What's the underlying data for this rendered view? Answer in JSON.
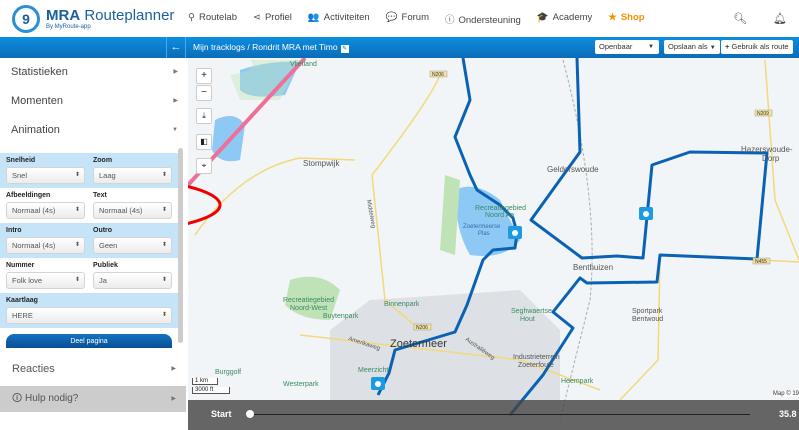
{
  "header": {
    "brand": "MRA Routeplanner",
    "brand_bold": "MRA",
    "brand_rest": "Routeplanner",
    "tagline": "By MyRoute-app",
    "nav": [
      {
        "label": "Routelab",
        "icon": "map-pin-icon"
      },
      {
        "label": "Profiel",
        "icon": "share-icon"
      },
      {
        "label": "Activiteiten",
        "icon": "users-icon"
      },
      {
        "label": "Forum",
        "icon": "comments-icon"
      },
      {
        "label": "Ondersteuning",
        "icon": "info-icon"
      },
      {
        "label": "Academy",
        "icon": "graduation-cap-icon"
      },
      {
        "label": "Shop",
        "icon": "star-icon"
      }
    ]
  },
  "toolbar": {
    "breadcrumb_root": "Mijn tracklogs",
    "breadcrumb_sep": "/",
    "breadcrumb_current": "Rondrit MRA met Timo",
    "visibility": "Openbaar",
    "save_as": "Opslaan als",
    "use_as_route": "Gebruik als route"
  },
  "sidebar": {
    "sections": [
      "Statistieken",
      "Momenten",
      "Animation"
    ],
    "fields": {
      "snelheid": {
        "label": "Snelheid",
        "value": "Snel"
      },
      "zoom": {
        "label": "Zoom",
        "value": "Laag"
      },
      "afbeeldingen": {
        "label": "Afbeeldingen",
        "value": "Normaal (4s)"
      },
      "text": {
        "label": "Text",
        "value": "Normaal (4s)"
      },
      "intro": {
        "label": "Intro",
        "value": "Normaal (4s)"
      },
      "outro": {
        "label": "Outro",
        "value": "Geen"
      },
      "nummer": {
        "label": "Nummer",
        "value": "Folk love"
      },
      "publiek": {
        "label": "Publiek",
        "value": "Ja"
      },
      "kaartlaag": {
        "label": "Kaartlaag",
        "value": "HERE"
      }
    },
    "share": "Deel pagina",
    "reacties": "Reacties",
    "help": "Hulp nodig?"
  },
  "map": {
    "labels": {
      "vlietland": "Vlietland",
      "stompwijk": "Stompwijk",
      "middelweg": "Middelweg",
      "gelderswoude": "Gelderswoude",
      "hazerswoude": "Hazerswoude-",
      "hazerswoude2": "Dorp",
      "benthuizen": "Benthuizen",
      "zoetermeer": "Zoetermeer",
      "recnw": "Recreatiegebied",
      "recnw2": "Noord-West",
      "buytenpark": "Buytenpark",
      "binnenpark": "Binnenpark",
      "recna": "Recreatiegebied",
      "recna2": "Noord Aa",
      "plas": "Zoetermeerse",
      "plas2": "Plas",
      "seghwaert": "Seghwaertse",
      "seghwaert2": "Hout",
      "sportpark": "Sportpark",
      "sportpark2": "Bentwoud",
      "industrie": "Industrieterrein",
      "industrie2": "Zoeterfoute",
      "heempark": "Heempark",
      "westerpark": "Westerpark",
      "burggolf": "Burggolf",
      "meerzicht": "Meerzicht",
      "amerikaweg": "Amerikaweg",
      "australieweg": "Australiëweg",
      "n206": "N206",
      "n209": "N209",
      "n455": "N455"
    },
    "scale_km": "1 km",
    "scale_ft": "3000 ft",
    "attribution": "Map © 19"
  },
  "player": {
    "start": "Start",
    "end": "35.8",
    "progress": 0
  },
  "colors": {
    "route": "#0a62b5",
    "accent": "#f39200",
    "bar": "#0a7ccc"
  }
}
